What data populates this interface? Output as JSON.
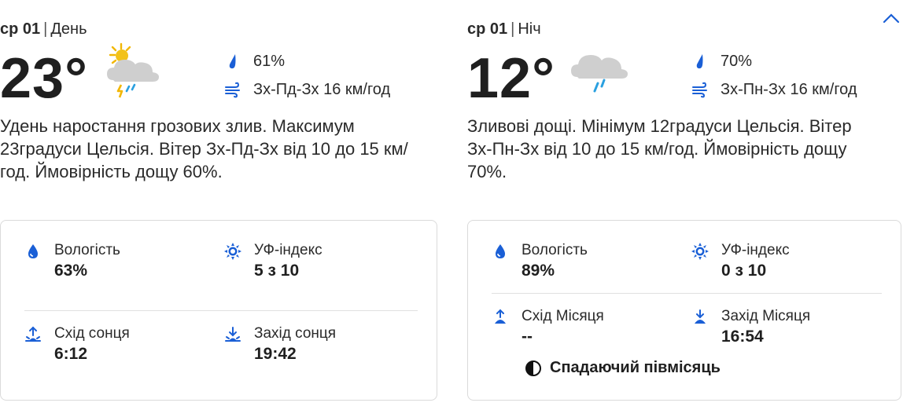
{
  "day": {
    "date": "ср 01",
    "period": "День",
    "temp": "23°",
    "weather_icon": "thunderstorm-sun-icon",
    "rain_chance": "61%",
    "wind": "Зх-Пд-Зх 16 км/год",
    "description": "Удень наростання грозових злив. Максимум 23градуси Цельсія. Вітер Зх-Пд-Зх від 10 до 15 км/год. Ймовірність дощу 60%.",
    "details": {
      "humidity_label": "Вологість",
      "humidity": "63%",
      "uv_label": "УФ-індекс",
      "uv": "5 з 10",
      "sunrise_label": "Схід сонця",
      "sunrise": "6:12",
      "sunset_label": "Захід сонця",
      "sunset": "19:42"
    }
  },
  "night": {
    "date": "ср 01",
    "period": "Ніч",
    "temp": "12°",
    "weather_icon": "rain-cloud-icon",
    "rain_chance": "70%",
    "wind": "Зх-Пн-Зх 16 км/год",
    "description": "Зливові дощі. Мінімум 12градуси Цельсія. Вітер Зх-Пн-Зх від 10 до 15 км/год. Ймовірність дощу 70%.",
    "details": {
      "humidity_label": "Вологість",
      "humidity": "89%",
      "uv_label": "УФ-індекс",
      "uv": "0 з 10",
      "moonrise_label": "Схід Місяця",
      "moonrise": "--",
      "moonset_label": "Захід Місяця",
      "moonset": "16:54",
      "moon_phase": "Спадаючий півмісяць"
    }
  },
  "colors": {
    "accent": "#1a5fd6",
    "text": "#1f1f1f",
    "border": "#dadada"
  }
}
